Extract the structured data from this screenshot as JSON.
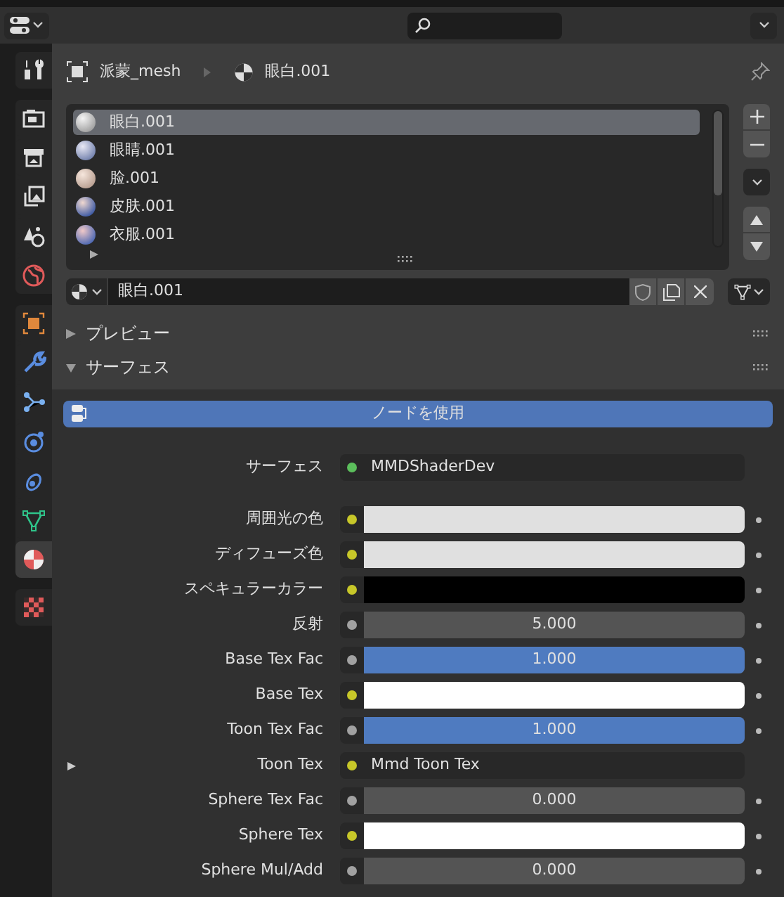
{
  "sidebar": {
    "tabs": [
      {
        "kind": "tool",
        "selected": false
      },
      {
        "kind": "render",
        "selected": false
      },
      {
        "kind": "output",
        "selected": false
      },
      {
        "kind": "view",
        "selected": false
      },
      {
        "kind": "scene",
        "selected": false
      },
      {
        "kind": "world",
        "selected": false
      },
      {
        "kind": "object",
        "selected": false
      },
      {
        "kind": "modifier",
        "selected": false
      },
      {
        "kind": "particles",
        "selected": false
      },
      {
        "kind": "physics",
        "selected": false
      },
      {
        "kind": "constraint",
        "selected": false
      },
      {
        "kind": "data",
        "selected": false
      },
      {
        "kind": "material",
        "selected": true
      },
      {
        "kind": "texture",
        "selected": false
      }
    ]
  },
  "breadcrumb": {
    "object": "派蒙_mesh",
    "material": "眼白.001"
  },
  "material_slots": [
    {
      "name": "眼白.001",
      "selected": true
    },
    {
      "name": "眼睛.001",
      "selected": false
    },
    {
      "name": "脸.001",
      "selected": false
    },
    {
      "name": "皮肤.001",
      "selected": false
    },
    {
      "name": "衣服.001",
      "selected": false
    }
  ],
  "material_field": {
    "value": "眼白.001"
  },
  "panels": [
    {
      "title": "プレビュー",
      "expanded": false
    },
    {
      "title": "サーフェス",
      "expanded": true
    }
  ],
  "use_nodes_button": "ノードを使用",
  "properties": [
    {
      "kind": "link",
      "label": "サーフェス",
      "color": "#5cbf5c",
      "value": "MMDShaderDev"
    },
    {
      "kind": "color",
      "label": "周囲光の色",
      "color": "#c7c729",
      "swatch": {
        "color": "#e0e0e0"
      }
    },
    {
      "kind": "color",
      "label": "ディフューズ色",
      "color": "#c7c729",
      "swatch": {
        "color": "#e0e0e0"
      }
    },
    {
      "kind": "color",
      "label": "スペキュラーカラー",
      "color": "#c7c729",
      "swatch": {
        "color": "#000000"
      }
    },
    {
      "kind": "number",
      "label": "反射",
      "color": "#a1a1a1",
      "value": "5.000",
      "level": 0
    },
    {
      "kind": "number",
      "label": "Base Tex Fac",
      "color": "#a1a1a1",
      "value": "1.000",
      "level": 1
    },
    {
      "kind": "color",
      "label": "Base Tex",
      "color": "#c7c729",
      "swatch": {
        "color": "#ffffff"
      }
    },
    {
      "kind": "number",
      "label": "Toon Tex Fac",
      "color": "#a1a1a1",
      "value": "1.000",
      "level": 1
    },
    {
      "kind": "link",
      "label": "Toon Tex",
      "color": "#c7c729",
      "value": "Mmd Toon Tex",
      "expandable": true
    },
    {
      "kind": "number",
      "label": "Sphere Tex Fac",
      "color": "#a1a1a1",
      "value": "0.000",
      "level": 0
    },
    {
      "kind": "color",
      "label": "Sphere Tex",
      "color": "#c7c729",
      "swatch": {
        "color": "#ffffff"
      }
    },
    {
      "kind": "number",
      "label": "Sphere Mul/Add",
      "color": "#a1a1a1",
      "value": "0.000",
      "level": 0
    }
  ]
}
